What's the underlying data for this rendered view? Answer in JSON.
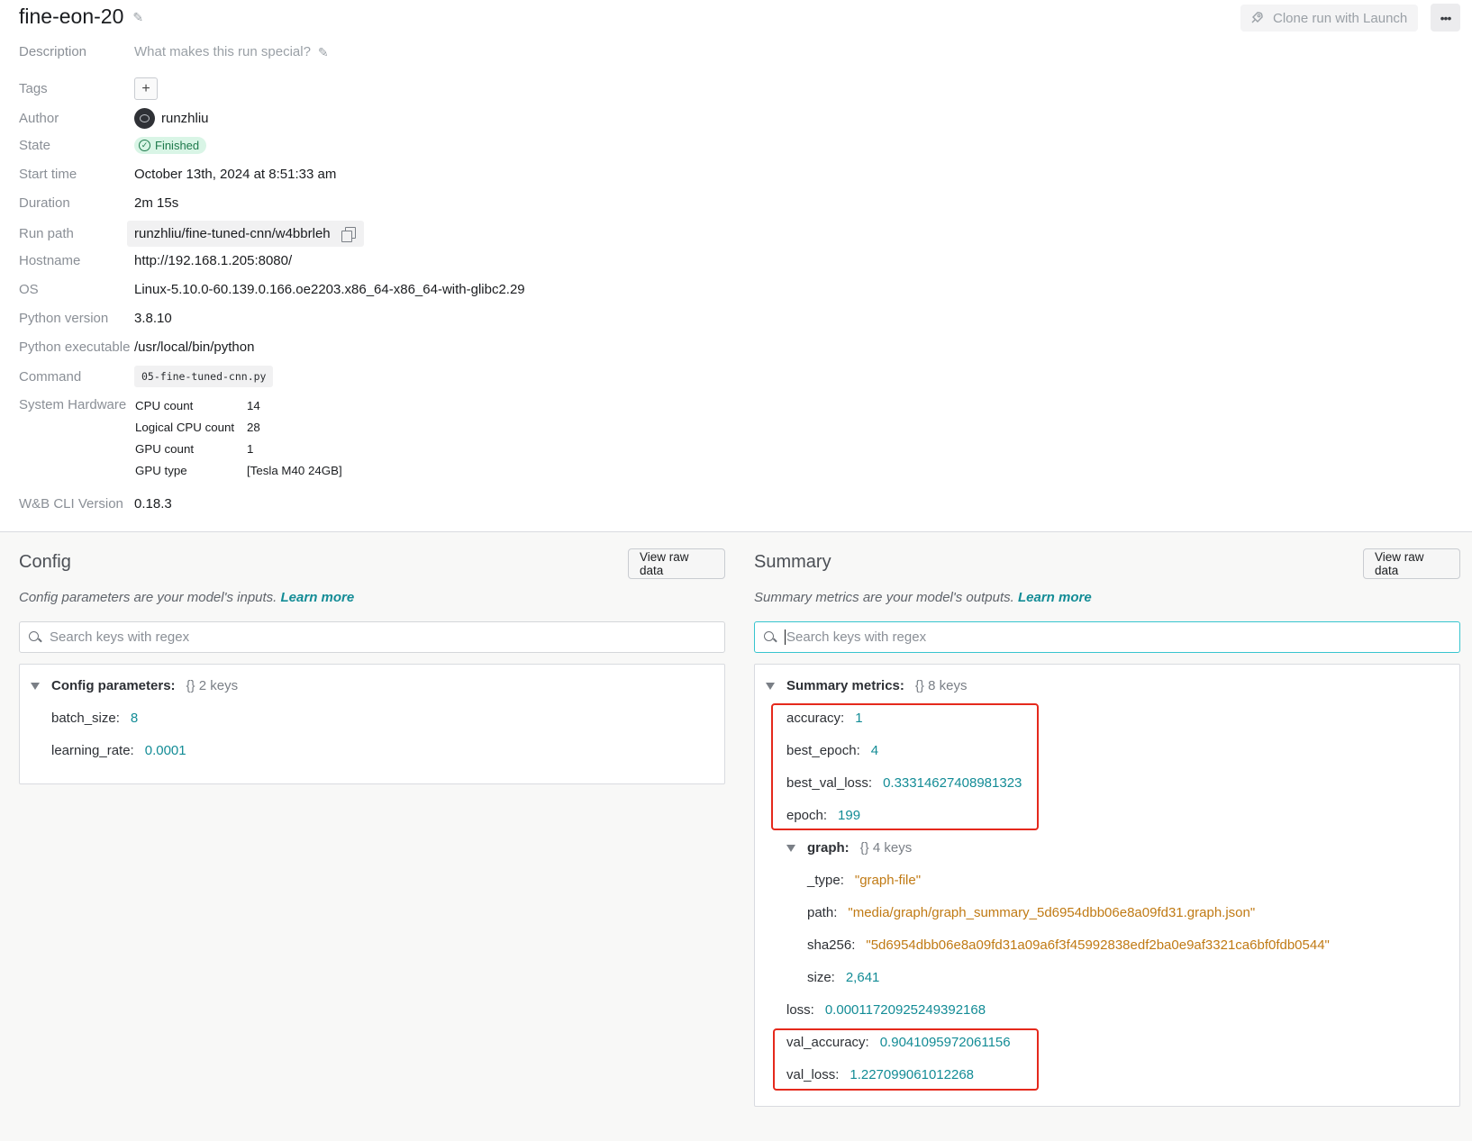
{
  "header": {
    "run_name": "fine-eon-20",
    "clone_label": "Clone run with Launch",
    "more_label": "•••"
  },
  "overview": {
    "description": {
      "label": "Description",
      "placeholder": "What makes this run special?"
    },
    "tags": {
      "label": "Tags",
      "add": "+"
    },
    "author": {
      "label": "Author",
      "value": "runzhliu"
    },
    "state": {
      "label": "State",
      "value": "Finished",
      "check": "✓"
    },
    "start_time": {
      "label": "Start time",
      "value": "October 13th, 2024 at 8:51:33 am"
    },
    "duration": {
      "label": "Duration",
      "value": "2m 15s"
    },
    "run_path": {
      "label": "Run path",
      "value": "runzhliu/fine-tuned-cnn/w4bbrleh"
    },
    "hostname": {
      "label": "Hostname",
      "value": "http://192.168.1.205:8080/"
    },
    "os": {
      "label": "OS",
      "value": "Linux-5.10.0-60.139.0.166.oe2203.x86_64-x86_64-with-glibc2.29"
    },
    "python_version": {
      "label": "Python version",
      "value": "3.8.10"
    },
    "python_executable": {
      "label": "Python executable",
      "value": "/usr/local/bin/python"
    },
    "command": {
      "label": "Command",
      "value": "05-fine-tuned-cnn.py"
    },
    "system_hardware": {
      "label": "System Hardware",
      "items": [
        {
          "key": "CPU count",
          "value": "14"
        },
        {
          "key": "Logical CPU count",
          "value": "28"
        },
        {
          "key": "GPU count",
          "value": "1"
        },
        {
          "key": "GPU type",
          "value": "[Tesla M40 24GB]"
        }
      ]
    },
    "cli_version": {
      "label": "W&B CLI Version",
      "value": "0.18.3"
    }
  },
  "config": {
    "title": "Config",
    "raw_button": "View raw data",
    "subtitle": "Config parameters are your model's inputs.",
    "learn_more": "Learn more",
    "search_placeholder": "Search keys with regex",
    "group_name": "Config parameters:",
    "group_meta": "{}  2 keys",
    "items": [
      {
        "key": "batch_size:",
        "value": "8"
      },
      {
        "key": "learning_rate:",
        "value": "0.0001"
      }
    ]
  },
  "summary": {
    "title": "Summary",
    "raw_button": "View raw data",
    "subtitle": "Summary metrics are your model's outputs.",
    "learn_more": "Learn more",
    "search_placeholder": "Search keys with regex",
    "group_name": "Summary metrics:",
    "group_meta": "{}  8 keys",
    "items": [
      {
        "key": "accuracy:",
        "value": "1"
      },
      {
        "key": "best_epoch:",
        "value": "4"
      },
      {
        "key": "best_val_loss:",
        "value": "0.33314627408981323"
      },
      {
        "key": "epoch:",
        "value": "199"
      }
    ],
    "graph": {
      "name": "graph:",
      "meta": "{}  4 keys",
      "items": [
        {
          "key": "_type:",
          "value": "\"graph-file\""
        },
        {
          "key": "path:",
          "value": "\"media/graph/graph_summary_5d6954dbb06e8a09fd31.graph.json\""
        },
        {
          "key": "sha256:",
          "value": "\"5d6954dbb06e8a09fd31a09a6f3f45992838edf2ba0e9af3321ca6bf0fdb0544\""
        },
        {
          "key": "size:",
          "value": "2,641"
        }
      ]
    },
    "tail_items": [
      {
        "key": "loss:",
        "value": "0.00011720925249392168"
      },
      {
        "key": "val_accuracy:",
        "value": "0.9041095972061156"
      },
      {
        "key": "val_loss:",
        "value": "1.227099061012268"
      }
    ]
  },
  "highlight_color": "#e5291c",
  "accent_color": "#138c96"
}
